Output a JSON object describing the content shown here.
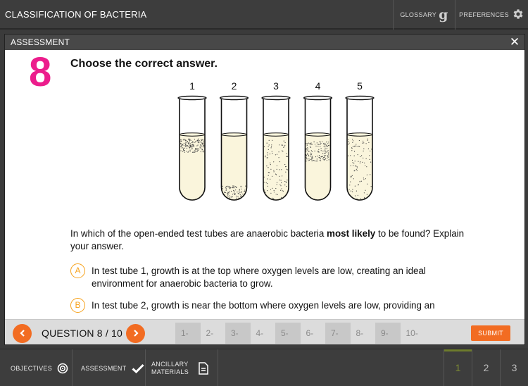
{
  "app": {
    "title": "CLASSIFICATION OF BACTERIA",
    "glossary_label": "GLOSSARY",
    "glossary_icon": "glossary-g-icon",
    "preferences_label": "PREFERENCES",
    "preferences_icon": "gear-icon"
  },
  "modal": {
    "title": "ASSESSMENT",
    "close_icon": "close-icon"
  },
  "question": {
    "number": "8",
    "prompt": "Choose the correct answer.",
    "tube_labels": [
      "1",
      "2",
      "3",
      "4",
      "5"
    ],
    "text_before": "In which of the open-ended test tubes are anaerobic bacteria ",
    "text_bold": "most likely",
    "text_after": " to be found? Explain your answer.",
    "options": [
      {
        "letter": "A",
        "text": "In test tube 1, growth is at the top where oxygen levels are low, creating an ideal environment for anaerobic bacteria to grow."
      },
      {
        "letter": "B",
        "text": "In test tube 2, growth is near the bottom where oxygen levels are low, providing an"
      }
    ]
  },
  "footer": {
    "counter": "QUESTION 8 / 10",
    "pages": [
      "1-",
      "2-",
      "3-",
      "4-",
      "5-",
      "6-",
      "7-",
      "8-",
      "9-",
      "10-"
    ],
    "submit_label": "SUBMIT",
    "accent_color": "#f26c22"
  },
  "bottom_nav": {
    "objectives_label": "OBJECTIVES",
    "objectives_icon": "target-icon",
    "assessment_label": "ASSESSMENT",
    "assessment_icon": "checkmark-icon",
    "ancillary_line1": "ANCILLARY",
    "ancillary_line2": "MATERIALS",
    "ancillary_icon": "document-icon",
    "page_numbers": [
      "1",
      "2",
      "3"
    ],
    "active_page": "1"
  },
  "colors": {
    "question_number": "#ec1d8c",
    "option_letter": "#f7a21b",
    "active_page": "#7c8a34"
  }
}
